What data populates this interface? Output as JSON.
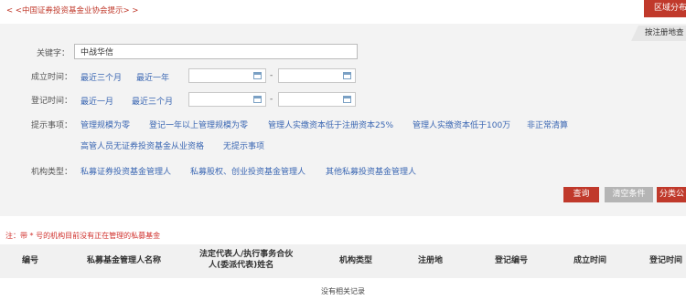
{
  "top_hint": "< <中国证券投资基金业协会提示> >",
  "tabs": {
    "region": "区域分布",
    "register": "按注册地查"
  },
  "form": {
    "keyword_label": "关键字：",
    "keyword_value": "中战华信",
    "established_label": "成立时间：",
    "established_options": [
      "最近三个月",
      "最近一年"
    ],
    "registered_label": "登记时间：",
    "registered_options": [
      "最近一月",
      "最近三个月"
    ],
    "date_separator": "-",
    "hints_label": "提示事项：",
    "hints_row1": [
      "管理规模为零",
      "登记一年以上管理规模为零",
      "管理人实缴资本低于注册资本25%",
      "管理人实缴资本低于100万",
      "非正常清算"
    ],
    "hints_row2": [
      "高管人员无证券投资基金从业资格",
      "无提示事项"
    ],
    "org_type_label": "机构类型：",
    "org_types": [
      "私募证券投资基金管理人",
      "私募股权、创业投资基金管理人",
      "其他私募投资基金管理人"
    ]
  },
  "buttons": {
    "query": "查询",
    "clear": "清空条件",
    "share": "分类公"
  },
  "note": "注：带 * 号的机构目前没有正在管理的私募基金",
  "table": {
    "headers": [
      "编号",
      "私募基金管理人名称",
      "法定代表人/执行事务合伙",
      "人(委派代表)姓名",
      "机构类型",
      "注册地",
      "登记编号",
      "成立时间",
      "登记时间"
    ],
    "empty_text": "没有相关记录"
  },
  "colors": {
    "accent_red": "#c0392b",
    "link_blue": "#3b67b3",
    "panel_bg": "#f3f3f3"
  },
  "icons": [
    "calendar-icon"
  ]
}
